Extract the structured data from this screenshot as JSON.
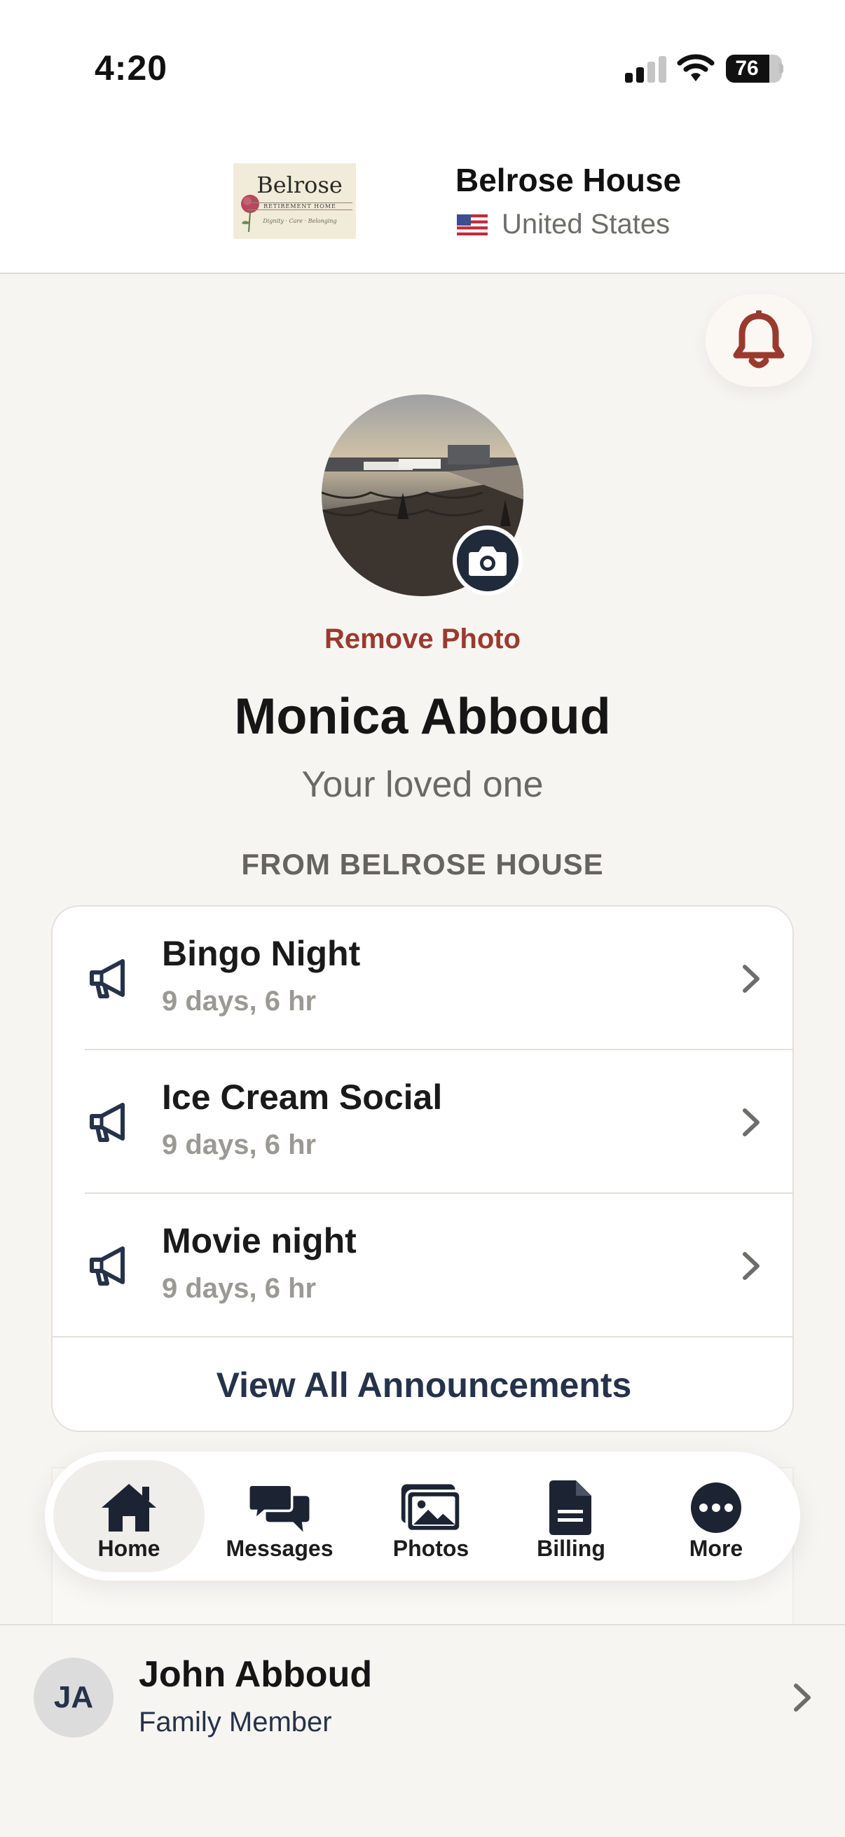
{
  "status_bar": {
    "time": "4:20",
    "battery": "76"
  },
  "header": {
    "logo": {
      "title": "Belrose",
      "subtitle": "RETIREMENT HOME",
      "tagline": "Dignity · Care · Belonging"
    },
    "facility_name": "Belrose House",
    "country": "United States",
    "flag_icon": "us-flag-icon"
  },
  "profile": {
    "remove_photo_label": "Remove Photo",
    "name": "Monica Abboud",
    "relation": "Your loved one"
  },
  "announcements": {
    "section_label": "FROM BELROSE HOUSE",
    "items": [
      {
        "title": "Bingo Night",
        "time": "9 days, 6 hr",
        "icon": "megaphone-icon"
      },
      {
        "title": "Ice Cream Social",
        "time": "9 days, 6 hr",
        "icon": "megaphone-icon"
      },
      {
        "title": "Movie night",
        "time": "9 days, 6 hr",
        "icon": "megaphone-icon"
      }
    ],
    "view_all_label": "View All Announcements"
  },
  "tab_bar": {
    "active": "Home",
    "tabs": [
      {
        "label": "Home",
        "icon": "home-icon"
      },
      {
        "label": "Messages",
        "icon": "chat-bubbles-icon"
      },
      {
        "label": "Photos",
        "icon": "photos-icon"
      },
      {
        "label": "Billing",
        "icon": "document-icon"
      },
      {
        "label": "More",
        "icon": "more-icon"
      }
    ]
  },
  "user": {
    "initials": "JA",
    "name": "John Abboud",
    "role": "Family Member"
  },
  "colors": {
    "accent": "#9a3a2e",
    "navy": "#25324a",
    "background": "#f7f5f1"
  }
}
